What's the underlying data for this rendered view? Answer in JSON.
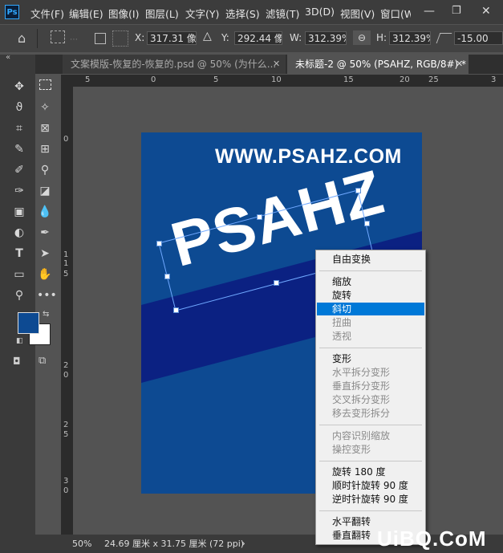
{
  "app": {
    "logo": "Ps"
  },
  "menubar": {
    "items": [
      "文件(F)",
      "编辑(E)",
      "图像(I)",
      "图层(L)",
      "文字(Y)",
      "选择(S)",
      "滤镜(T)",
      "3D(D)",
      "视图(V)",
      "窗口(W"
    ]
  },
  "options": {
    "x_label": "X:",
    "x_value": "317.31 像素",
    "y_label": "Y:",
    "y_value": "292.44 像素",
    "w_label": "W:",
    "w_value": "312.39%",
    "h_label": "H:",
    "h_value": "312.39%",
    "angle_value": "-15.00"
  },
  "tabs": [
    {
      "label": "文案模版-恢复的-恢复的.psd @ 50% (为什么...",
      "active": false
    },
    {
      "label": "未标题-2 @ 50% (PSAHZ, RGB/8#) *",
      "active": true
    }
  ],
  "rulers": {
    "top": [
      "5",
      "0",
      "5",
      "10",
      "15",
      "20",
      "25",
      "3"
    ],
    "left": [
      "0",
      "1",
      "1",
      "5",
      "2",
      "0",
      "2",
      "5",
      "3",
      "0"
    ]
  },
  "canvas": {
    "url_text": "WWW.PSAHZ.COM",
    "headline": "PSAHZ",
    "colors": {
      "background": "#0d4a92",
      "band": "#0b2182",
      "text": "#ffffff"
    }
  },
  "statusbar": {
    "zoom": "50%",
    "doc_size": "24.69 厘米 x 31.75 厘米 (72 ppi)"
  },
  "context_menu": {
    "items": [
      {
        "label": "自由变换",
        "state": "enabled"
      },
      {
        "label": "缩放",
        "state": "enabled"
      },
      {
        "label": "旋转",
        "state": "enabled"
      },
      {
        "label": "斜切",
        "state": "selected"
      },
      {
        "label": "扭曲",
        "state": "disabled"
      },
      {
        "label": "透视",
        "state": "disabled"
      },
      {
        "label": "变形",
        "state": "enabled"
      },
      {
        "label": "水平拆分变形",
        "state": "disabled"
      },
      {
        "label": "垂直拆分变形",
        "state": "disabled"
      },
      {
        "label": "交叉拆分变形",
        "state": "disabled"
      },
      {
        "label": "移去变形拆分",
        "state": "disabled"
      },
      {
        "label": "内容识别缩放",
        "state": "disabled"
      },
      {
        "label": "操控变形",
        "state": "disabled"
      },
      {
        "label": "旋转 180 度",
        "state": "enabled"
      },
      {
        "label": "顺时针旋转 90 度",
        "state": "enabled"
      },
      {
        "label": "逆时针旋转 90 度",
        "state": "enabled"
      },
      {
        "label": "水平翻转",
        "state": "enabled"
      },
      {
        "label": "垂直翻转",
        "state": "enabled"
      }
    ]
  },
  "watermark": "UiBQ.CoM",
  "tools": [
    "move-icon",
    "marquee-icon",
    "lasso-icon",
    "magic-wand-icon",
    "crop-icon",
    "frame-icon",
    "eyedropper-icon",
    "healing-icon",
    "brush-icon",
    "stamp-icon",
    "history-brush-icon",
    "eraser-icon",
    "gradient-icon",
    "blur-icon",
    "dodge-icon",
    "pen-icon",
    "type-icon",
    "path-select-icon",
    "rectangle-icon",
    "hand-icon",
    "zoom-icon",
    "more-icon"
  ],
  "swatches": {
    "foreground": "#0d4a92",
    "background": "#ffffff"
  }
}
